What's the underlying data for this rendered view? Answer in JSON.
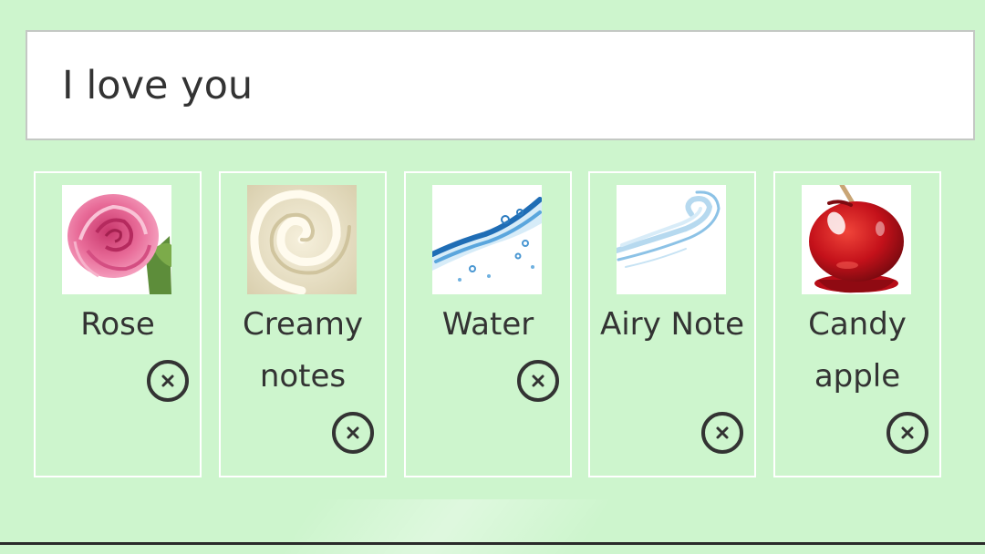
{
  "message": {
    "value": "I love you"
  },
  "notes": [
    {
      "label": "Rose",
      "image": "rose-image"
    },
    {
      "label": "Creamy notes",
      "image": "cream-swirl-image"
    },
    {
      "label": "Water",
      "image": "water-splash-image"
    },
    {
      "label": "Airy Note",
      "image": "air-swirl-image"
    },
    {
      "label": "Candy apple",
      "image": "candy-apple-image"
    }
  ],
  "icons": {
    "remove": "close-circle-icon"
  },
  "colors": {
    "background": "#cdf5cd",
    "card_border": "#ffffff",
    "text": "#333333"
  }
}
